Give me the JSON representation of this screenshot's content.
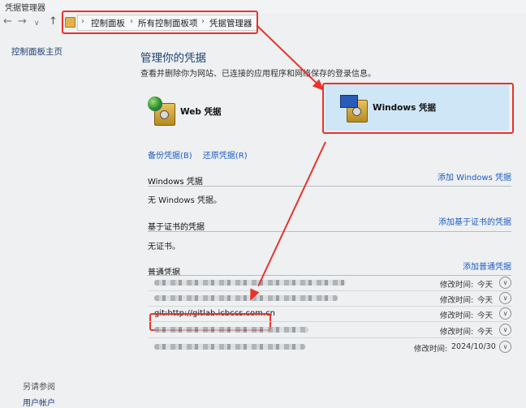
{
  "window": {
    "title": "凭据管理器"
  },
  "nav": {
    "back": "←",
    "forward": "→",
    "dropdown": "∨",
    "up": "↑",
    "breadcrumbs": [
      "控制面板",
      "所有控制面板项",
      "凭据管理器"
    ]
  },
  "sidebar": {
    "home": "控制面板主页",
    "see_also": "另请参阅",
    "user_accounts": "用户帐户"
  },
  "main": {
    "title": "管理你的凭据",
    "description": "查看并删除你为网站、已连接的应用程序和网络保存的登录信息。",
    "tiles": {
      "web": "Web 凭据",
      "windows": "Windows 凭据"
    },
    "backup": "备份凭据(B)",
    "restore": "还原凭据(R)",
    "sections": {
      "windows": {
        "header": "Windows 凭据",
        "add": "添加 Windows 凭据",
        "empty": "无 Windows 凭据。"
      },
      "certificate": {
        "header": "基于证书的凭据",
        "add": "添加基于证书的凭据",
        "empty": "无证书。"
      },
      "generic": {
        "header": "普通凭据",
        "add": "添加普通凭据",
        "items": [
          {
            "name": "",
            "modified_label": "修改时间:",
            "modified": "今天"
          },
          {
            "name": "",
            "modified_label": "修改时间:",
            "modified": "今天"
          },
          {
            "name": "git:http://gitlab.icbccs.com.cn",
            "modified_label": "修改时间:",
            "modified": "今天"
          },
          {
            "name": "",
            "modified_label": "修改时间:",
            "modified": "今天"
          },
          {
            "name": "",
            "modified_label": "修改时间:",
            "modified": "2024/10/30"
          }
        ]
      }
    }
  },
  "colors": {
    "highlight": "#cfe6f7",
    "annotation": "#e8332b",
    "link": "#1e5bc6"
  }
}
